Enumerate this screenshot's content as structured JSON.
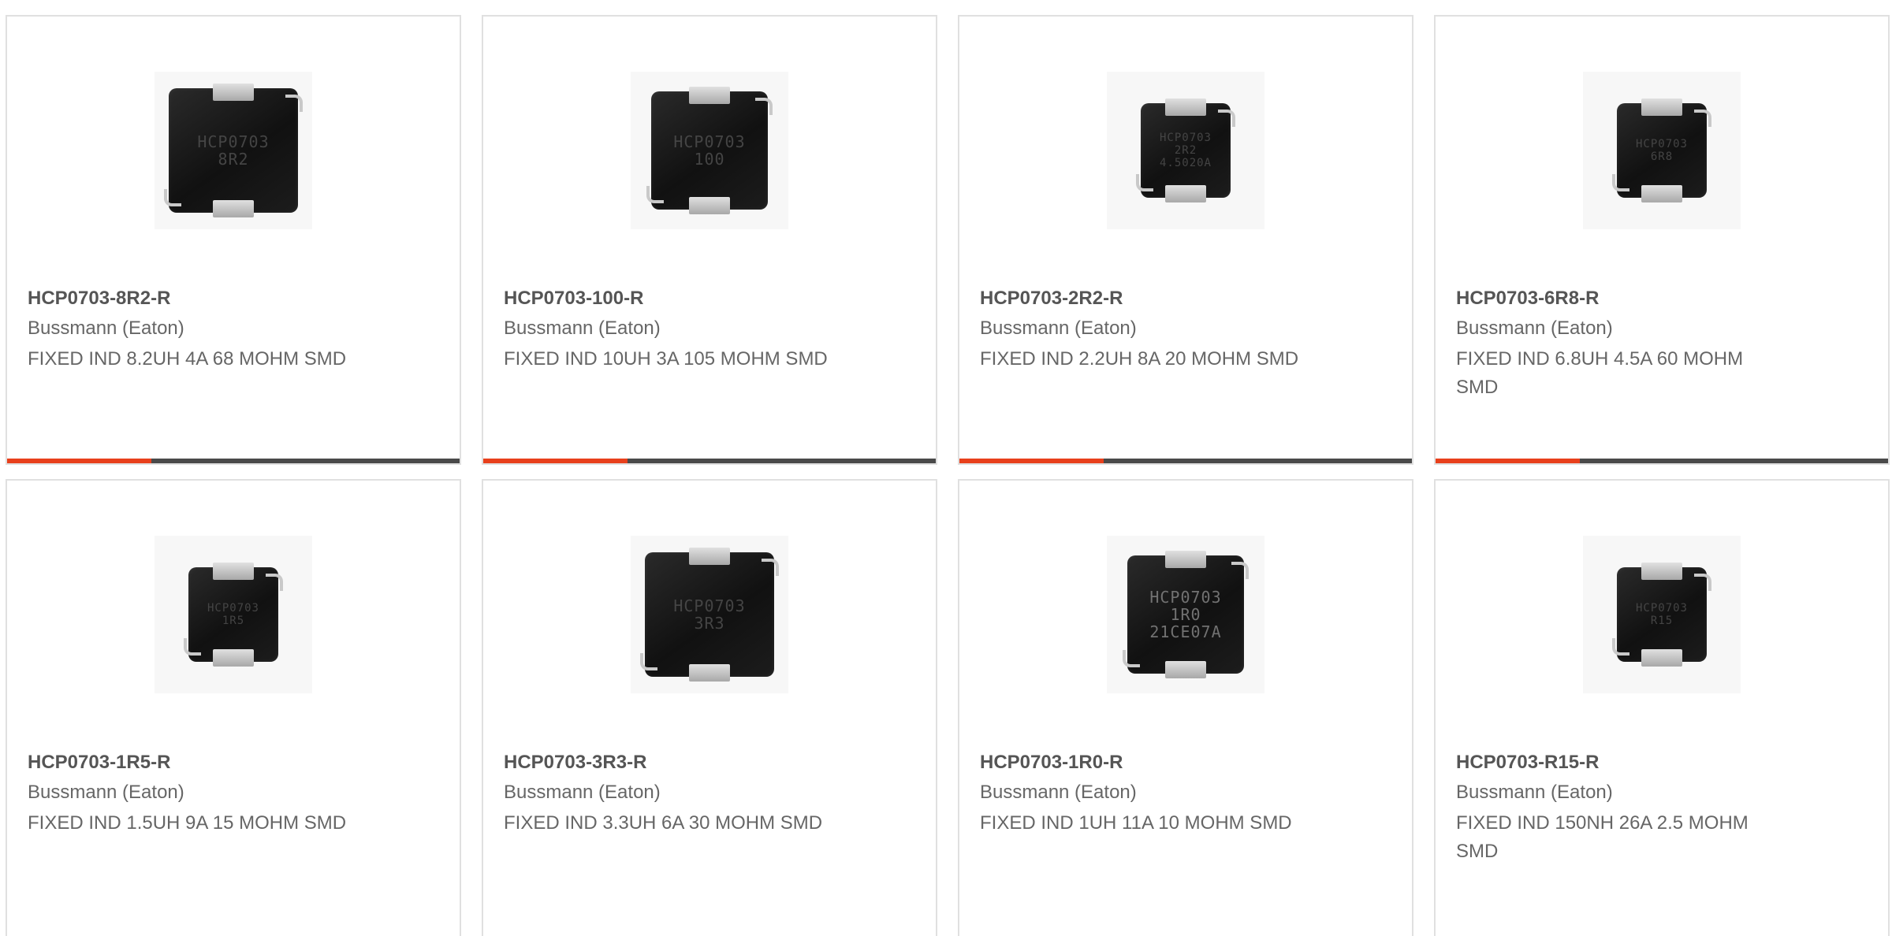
{
  "colors": {
    "accent": "#e8401c",
    "bar_track": "#4a4a4a",
    "text_bold": "#555555",
    "text": "#666666",
    "card_border": "#e0e0e0"
  },
  "cards": [
    {
      "part_number": "HCP0703-8R2-R",
      "manufacturer": "Bussmann (Eaton)",
      "description": "FIXED IND 8.2UH 4A 68 MOHM SMD",
      "marking": [
        "HCP0703",
        "8R2"
      ],
      "progress_fraction": 0.32
    },
    {
      "part_number": "HCP0703-100-R",
      "manufacturer": "Bussmann (Eaton)",
      "description": "FIXED IND 10UH 3A 105 MOHM SMD",
      "marking": [
        "HCP0703",
        "100"
      ],
      "progress_fraction": 0.32
    },
    {
      "part_number": "HCP0703-2R2-R",
      "manufacturer": "Bussmann (Eaton)",
      "description": "FIXED IND 2.2UH 8A 20 MOHM SMD",
      "marking": [
        "HCP0703",
        "2R2",
        "4.5020A"
      ],
      "progress_fraction": 0.32
    },
    {
      "part_number": "HCP0703-6R8-R",
      "manufacturer": "Bussmann (Eaton)",
      "description": "FIXED IND 6.8UH 4.5A 60 MOHM SMD",
      "marking": [
        "HCP0703",
        "6R8"
      ],
      "progress_fraction": 0.32
    },
    {
      "part_number": "HCP0703-1R5-R",
      "manufacturer": "Bussmann (Eaton)",
      "description": "FIXED IND 1.5UH 9A 15 MOHM SMD",
      "marking": [
        "HCP0703",
        "1R5"
      ]
    },
    {
      "part_number": "HCP0703-3R3-R",
      "manufacturer": "Bussmann (Eaton)",
      "description": "FIXED IND 3.3UH 6A 30 MOHM SMD",
      "marking": [
        "HCP0703",
        "3R3"
      ]
    },
    {
      "part_number": "HCP0703-1R0-R",
      "manufacturer": "Bussmann (Eaton)",
      "description": "FIXED IND 1UH 11A 10 MOHM SMD",
      "marking": [
        "HCP0703",
        "1R0",
        "21CE07A"
      ]
    },
    {
      "part_number": "HCP0703-R15-R",
      "manufacturer": "Bussmann (Eaton)",
      "description": "FIXED IND 150NH 26A 2.5 MOHM SMD",
      "marking": [
        "HCP0703",
        "R15"
      ]
    }
  ]
}
